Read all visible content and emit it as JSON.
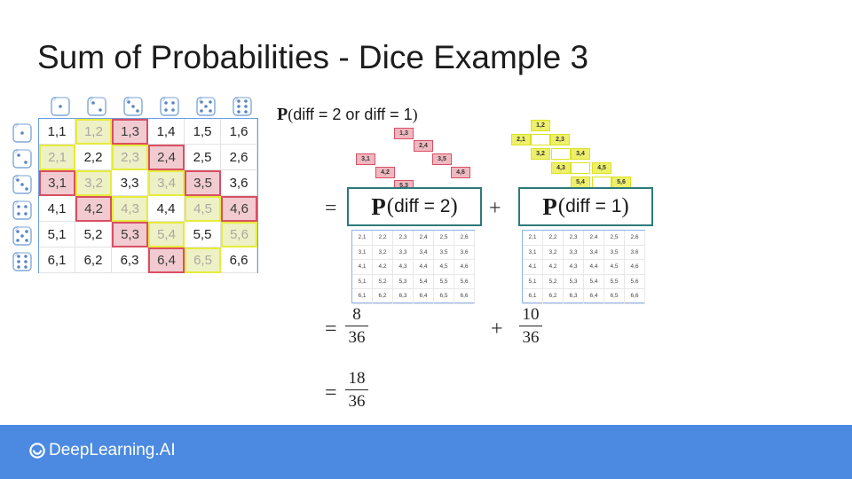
{
  "slide": {
    "title": "Sum of Probabilities - Dice Example 3"
  },
  "dice_grid": {
    "rows": [
      [
        "1,1",
        "1,2",
        "1,3",
        "1,4",
        "1,5",
        "1,6"
      ],
      [
        "2,1",
        "2,2",
        "2,3",
        "2,4",
        "2,5",
        "2,6"
      ],
      [
        "3,1",
        "3,2",
        "3,3",
        "3,4",
        "3,5",
        "3,6"
      ],
      [
        "4,1",
        "4,2",
        "4,3",
        "4,4",
        "4,5",
        "4,6"
      ],
      [
        "5,1",
        "5,2",
        "5,3",
        "5,4",
        "5,5",
        "5,6"
      ],
      [
        "6,1",
        "6,2",
        "6,3",
        "6,4",
        "6,5",
        "6,6"
      ]
    ],
    "highlight": [
      [
        "",
        "y",
        "r",
        "",
        "",
        ""
      ],
      [
        "y",
        "",
        "y",
        "r",
        "",
        ""
      ],
      [
        "r",
        "y",
        "",
        "y",
        "r",
        ""
      ],
      [
        "",
        "r",
        "y",
        "",
        "y",
        "r"
      ],
      [
        "",
        "",
        "r",
        "y",
        "",
        "y"
      ],
      [
        "",
        "",
        "",
        "r",
        "y",
        ""
      ]
    ],
    "colors": {
      "red_fill": "#f1cbd0",
      "red_border": "#d94f63",
      "yellow_fill": "#eef0c6",
      "yellow_border": "#e6ec3a"
    },
    "column_dice_icons": [
      "die-1-icon",
      "die-2-icon",
      "die-3-icon",
      "die-4-icon",
      "die-5-icon",
      "die-6-icon"
    ],
    "row_dice_icons": [
      "die-1-icon",
      "die-2-icon",
      "die-3-icon",
      "die-4-icon",
      "die-5-icon",
      "die-6-icon"
    ]
  },
  "formula": {
    "header_p": "P",
    "header_expr": "diff = 2 or diff = 1",
    "equals": "=",
    "plus": "+",
    "left_box_p": "P",
    "left_box_expr": "diff = 2",
    "right_box_p": "P",
    "right_box_expr": "diff = 1",
    "diff2_cells": [
      "1,3",
      "2,4",
      "3,1",
      "3,5",
      "4,2",
      "4,6",
      "5,3"
    ],
    "diff1_cells": [
      "1,2",
      "2,1",
      "2,3",
      "3,2",
      "3,4",
      "4,3",
      "4,5",
      "5,4",
      "5,6"
    ],
    "frac1": {
      "num": "8",
      "den": "36"
    },
    "frac2": {
      "num": "10",
      "den": "36"
    },
    "frac3": {
      "num": "18",
      "den": "36"
    }
  },
  "small_grid": {
    "rows": [
      [
        "2,1",
        "2,2",
        "2,3",
        "2,4",
        "2,5",
        "2,6"
      ],
      [
        "3,1",
        "3,2",
        "3,3",
        "3,4",
        "3,5",
        "3,6"
      ],
      [
        "4,1",
        "4,2",
        "4,3",
        "4,4",
        "4,5",
        "4,6"
      ],
      [
        "5,1",
        "5,2",
        "5,3",
        "5,4",
        "5,5",
        "5,6"
      ],
      [
        "6,1",
        "6,2",
        "6,3",
        "6,4",
        "6,5",
        "6,6"
      ]
    ]
  },
  "footer": {
    "brand": "DeepLearning.AI",
    "brand_icon": "deeplearning-logo-icon",
    "color": "#4b8ae0"
  }
}
